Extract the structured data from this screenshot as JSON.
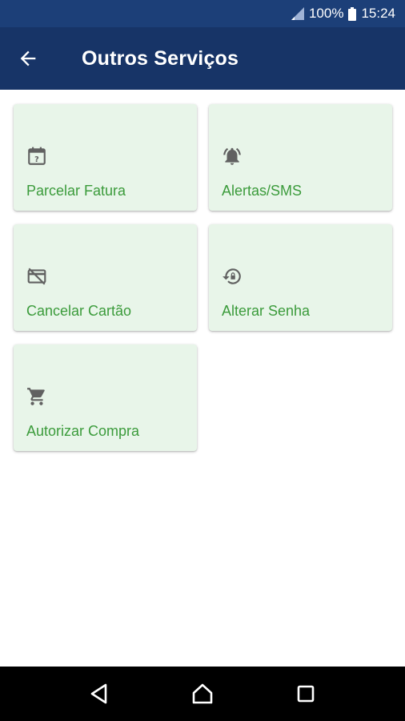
{
  "status_bar": {
    "battery": "100%",
    "time": "15:24",
    "icons": [
      "signal-icon",
      "battery-icon"
    ]
  },
  "app_bar": {
    "title": "Outros Serviços",
    "back_icon": "arrow-back-icon"
  },
  "services": [
    {
      "label": "Parcelar Fatura",
      "icon": "calendar-question-icon"
    },
    {
      "label": "Alertas/SMS",
      "icon": "bell-ringing-icon"
    },
    {
      "label": "Cancelar Cartão",
      "icon": "card-off-icon"
    },
    {
      "label": "Alterar Senha",
      "icon": "lock-reset-icon"
    },
    {
      "label": "Autorizar Compra",
      "icon": "cart-icon"
    }
  ],
  "nav_bar": {
    "icons": [
      "back-triangle-icon",
      "home-icon",
      "recents-square-icon"
    ]
  },
  "colors": {
    "status_bar": "#1c3f78",
    "app_bar": "#173467",
    "card_bg": "#e8f5e9",
    "card_label": "#3b9b3b",
    "icon_gray": "#616161"
  }
}
